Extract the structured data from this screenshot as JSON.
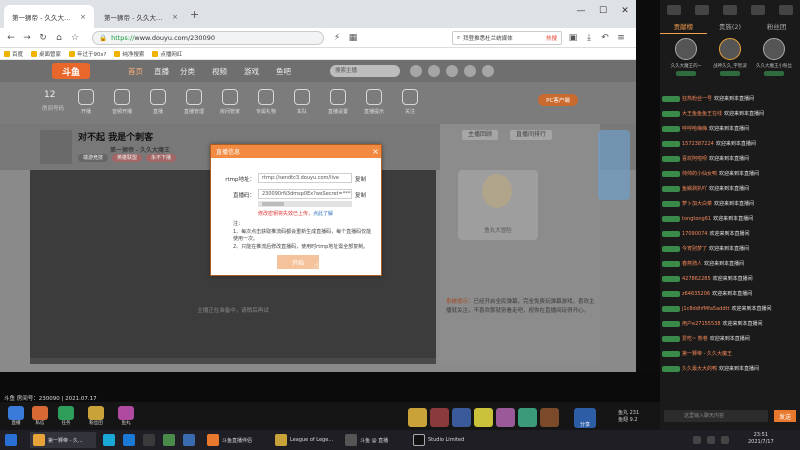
{
  "browser": {
    "tabs": [
      {
        "label": "第一狮帝 - 久久大魔王直播间_斗"
      },
      {
        "label": "第一狮帝 - 久久大魔王的..."
      }
    ],
    "new_tab": "+",
    "url_host": "https://",
    "url_domain": "www.douyu.com/230090",
    "window_controls": [
      "—",
      "☐",
      "✕"
    ],
    "search_placeholder": "拜登推悉杜兰统媒体",
    "search_hot": "热搜",
    "bookmarks": [
      "百度",
      "桌面管家",
      "年过于90s?",
      "纯净搜索",
      "点播网红"
    ]
  },
  "site": {
    "logo": "斗鱼",
    "nav": [
      "首页",
      "直播",
      "分类",
      "视频",
      "游戏",
      "鱼吧"
    ],
    "search_placeholder": "搜索主播",
    "room_number": "12",
    "room_number_label": "房间号码",
    "gear_items": [
      "开播",
      "音频开播",
      "直播",
      "直播管理",
      "房间管家",
      "专属礼物",
      "车队",
      "直播设置",
      "直播提示",
      "关注"
    ],
    "pc_button": "PC客户端",
    "room_title": "对不起 我是个刺客",
    "anchor_name": "第一狮帝 - 久久大魔王",
    "tags": [
      "端游竞技",
      "英雄联盟",
      "永不下播"
    ],
    "stream_placeholder": "主播正在准备中，请稍后再试",
    "side_tabs": [
      "主播回顾",
      "直播间排行"
    ],
    "mascot_caption": "鱼丸大冒险",
    "system_message_label": "系统提示：",
    "system_message": "已经开启全民弹幕，完全免费玩弹幕游戏，喜欢主播就关注，不喜欢那就别看走吧，祝你在直播间玩得开心。"
  },
  "modal": {
    "title": "直播信息",
    "close": "×",
    "rtmp_label": "rtmp地址：",
    "rtmp_value": "rtmp://sendtc3.douyu.com/live",
    "code_label": "直播码：",
    "code_value": "230090rN3dmsp0Ex?wsSecret=*******",
    "copy_label": "复制",
    "warn_text": "修改密钥将失效已上传，",
    "warn_link": "点此了解",
    "notes_title": "注：",
    "notes": [
      "1、每次点击获取推流码都会重新生成直播码，每个直播码仅能使用一次。",
      "2、只能在推流后修改直播码，使用时rtmp地址需全部复制。"
    ],
    "start_button": "开始"
  },
  "status": {
    "text": "斗鱼 房间号：230090 | 2021.07.17"
  },
  "dock": {
    "buttons": [
      "直播",
      "私信",
      "任务",
      "粉丝团",
      "鱼丸"
    ],
    "share": "分享",
    "stats": [
      "鱼丸  231",
      "鱼翅  9.2"
    ]
  },
  "chat": {
    "tabs": [
      "贡献榜",
      "贵族(2)",
      "粉丝团"
    ],
    "contributors": [
      "久久大魔王的~",
      "战神久久_宇智波",
      "久久大魔王小粉丝"
    ],
    "messages": [
      {
        "user": "狂热粉丝一号",
        "text": "欢迎来到本直播间"
      },
      {
        "user": "大王鱼鱼鱼王在线",
        "text": "欢迎来到本直播间"
      },
      {
        "user": "呼呼哈嗨嗨",
        "text": "欢迎来到本直播间"
      },
      {
        "user": "1572387224",
        "text": "欢迎来到本直播间"
      },
      {
        "user": "喜欢阿啦呗",
        "text": "欢迎来到本直播间"
      },
      {
        "user": "帅帅的小仙女鸭",
        "text": "欢迎来到本直播间"
      },
      {
        "user": "鱼鳞涮扒吖",
        "text": "欢迎来到本直播间"
      },
      {
        "user": "萝卜加大白菜",
        "text": "欢迎来到本直播间"
      },
      {
        "user": "tongtong61",
        "text": "欢迎来到本直播间"
      },
      {
        "user": "17090074",
        "text": "欢迎来到本直播间"
      },
      {
        "user": "今宵别梦了",
        "text": "欢迎来到本直播间"
      },
      {
        "user": "春燕骑人",
        "text": "欢迎来到本直播间"
      },
      {
        "user": "427862285",
        "text": "欢迎来到本直播间"
      },
      {
        "user": "z64635206",
        "text": "欢迎来到本直播间"
      },
      {
        "user": "j1c8ddhfMfa5addtt",
        "text": "欢迎来到本直播间"
      },
      {
        "user": "用户e27155538",
        "text": "欢迎来到本直播间"
      },
      {
        "user": "爱吃~ 熊卷",
        "text": "欢迎来到本直播间"
      },
      {
        "user": "第一狮帝 - 久久大魔王",
        "text": ""
      },
      {
        "user": "久久最大大的鸭",
        "text": "欢迎来到本直播间"
      }
    ],
    "input_placeholder": "这里输入聊天内容",
    "send": "发送"
  },
  "taskbar": {
    "items": [
      "第一狮帝 - 久...",
      "",
      "",
      "",
      "",
      "",
      "斗鱼直播伴侣",
      "League of Legends",
      "斗鱼 @ 直播",
      "Studio Limited"
    ],
    "time": "23:51",
    "date": "2021/7/17"
  },
  "colors": {
    "accent": "#f28a41",
    "douyu_orange": "#e9672a",
    "chat_user": "#f4885a"
  }
}
